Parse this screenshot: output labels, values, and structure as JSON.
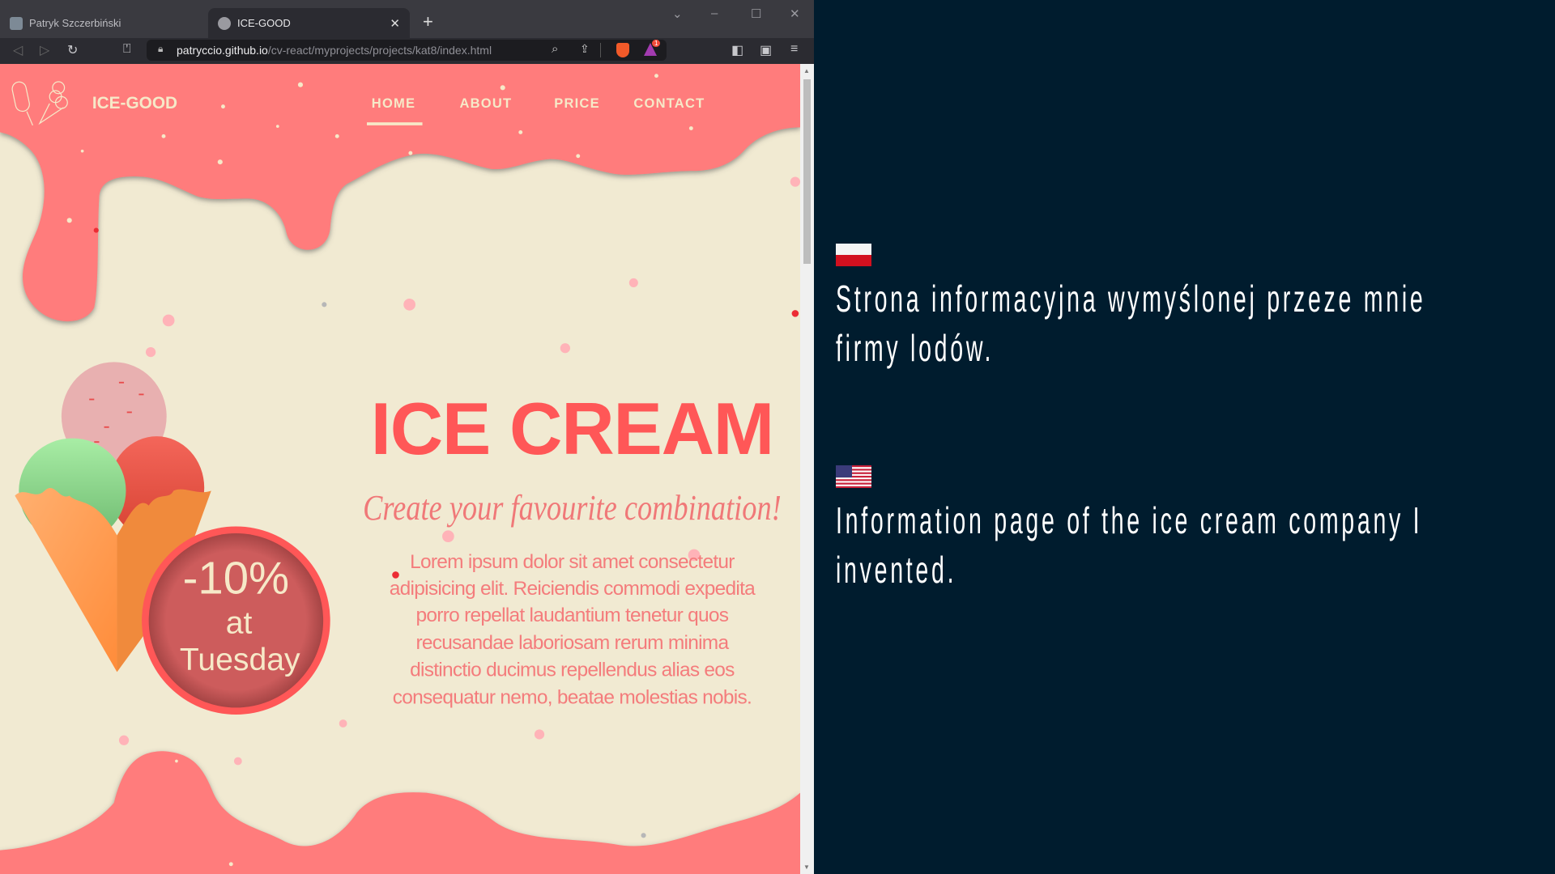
{
  "browser": {
    "tabs": [
      {
        "label": "Patryk Szczerbiński"
      },
      {
        "label": "ICE-GOOD"
      }
    ],
    "url_host": "patryccio.github.io",
    "url_path": "/cv-react/myprojects/projects/kat8/index.html",
    "notification_count": "1"
  },
  "site": {
    "brand": "ICE-GOOD",
    "nav": [
      {
        "label": "HOME"
      },
      {
        "label": "ABOUT"
      },
      {
        "label": "PRICE"
      },
      {
        "label": "CONTACT"
      }
    ],
    "title": "ICE CREAM",
    "subtitle": "Create your favourite combination!",
    "paragraph_lines": [
      "Lorem ipsum dolor sit amet consectetur",
      "adipisicing elit. Reiciendis commodi expedita",
      "porro repellat laudantium tenetur quos",
      "recusandae laboriosam rerum minima",
      "distinctio ducimus repellendus alias eos",
      "consequatur nemo, beatae molestias nobis."
    ],
    "badge": {
      "line1": "-10%",
      "line2": "at",
      "line3": "Tuesday"
    },
    "colors": {
      "pink": "#ff7b7b",
      "cream": "#f1ead2",
      "title": "#ff5757",
      "badge": "#cd5c5c"
    }
  },
  "panel": {
    "pl_lines": [
      "Strona informacyjna wymyślonej przeze mnie",
      "firmy lodów."
    ],
    "en_lines": [
      "Information page of the ice cream company I",
      "invented."
    ],
    "background": "#001c2e"
  }
}
